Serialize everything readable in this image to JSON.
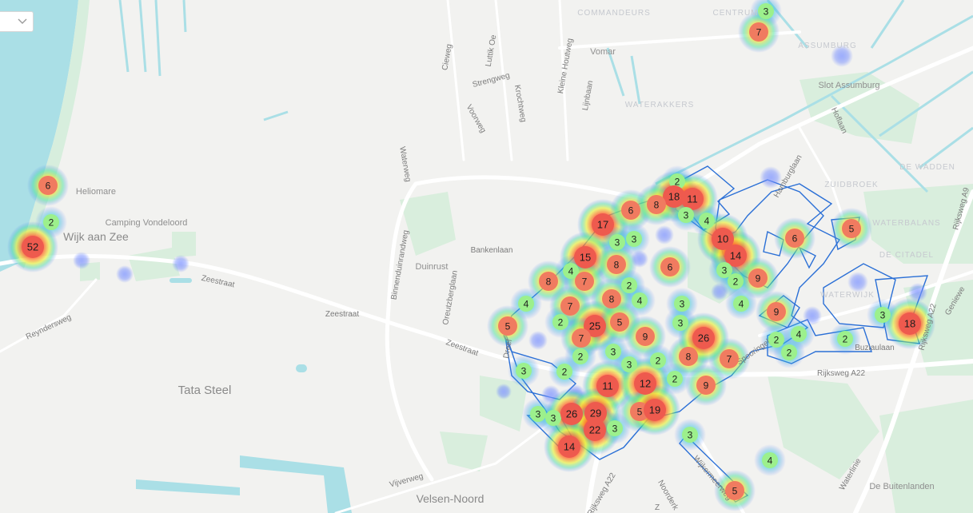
{
  "map": {
    "place_labels": [
      {
        "id": "commandeurs",
        "text": "COMMANDEURS",
        "variant": "district"
      },
      {
        "id": "centrum",
        "text": "CENTRUM",
        "variant": "district"
      },
      {
        "id": "assumburg",
        "text": "ASSUMBURG",
        "variant": "district"
      },
      {
        "id": "slot-assumburg",
        "text": "Slot Assumburg",
        "variant": "poi"
      },
      {
        "id": "waterakkers",
        "text": "WATERAKKERS",
        "variant": "district"
      },
      {
        "id": "zuidbroek",
        "text": "ZUIDBROEK",
        "variant": "district"
      },
      {
        "id": "de-wadden",
        "text": "DE WADDEN",
        "variant": "district"
      },
      {
        "id": "waterbalans",
        "text": "WATERBALANS",
        "variant": "district"
      },
      {
        "id": "de-citadel",
        "text": "DE CITADEL",
        "variant": "district"
      },
      {
        "id": "waterwijk",
        "text": "WATERWIJK",
        "variant": "district"
      },
      {
        "id": "heliomare",
        "text": "Heliomare",
        "variant": "poi"
      },
      {
        "id": "camping-vondeloord",
        "text": "Camping Vondeloord",
        "variant": "poi"
      },
      {
        "id": "wijk-aan-zee",
        "text": "Wijk aan Zee",
        "variant": "town"
      },
      {
        "id": "tata-steel",
        "text": "Tata Steel",
        "variant": "town"
      },
      {
        "id": "velsen-noord",
        "text": "Velsen-Noord",
        "variant": "town"
      },
      {
        "id": "duinrust",
        "text": "Duinrust",
        "variant": "poi"
      },
      {
        "id": "de-buitenlanden",
        "text": "De Buitenlanden",
        "variant": "poi"
      },
      {
        "id": "vomar",
        "text": "Vomar",
        "variant": "poi"
      }
    ],
    "street_labels": [
      {
        "id": "cieweg",
        "text": "Cieweg"
      },
      {
        "id": "luttik-oe",
        "text": "Luttik Oe"
      },
      {
        "id": "kleine-houtweg",
        "text": "Kleine Houtweg"
      },
      {
        "id": "lijnbaan",
        "text": "Lijnbaan"
      },
      {
        "id": "strengweg",
        "text": "Strengweg"
      },
      {
        "id": "voorweg",
        "text": "Voorweg"
      },
      {
        "id": "krocht",
        "text": "Krochtweg"
      },
      {
        "id": "waterweg",
        "text": "Waterweg"
      },
      {
        "id": "binnenduinrandweg",
        "text": "Binnenduinrandweg"
      },
      {
        "id": "bankenlaan",
        "text": "Bankenlaan"
      },
      {
        "id": "oreutzberglaan",
        "text": "Oreutzberglaan"
      },
      {
        "id": "zeestraat-1",
        "text": "Zeestraat"
      },
      {
        "id": "zeestraat-2",
        "text": "Zeestraat"
      },
      {
        "id": "zeestraat-3",
        "text": "Zeestraat"
      },
      {
        "id": "reyndersweg",
        "text": "Reyndersweg"
      },
      {
        "id": "dreef",
        "text": "Dreef"
      },
      {
        "id": "hoflaan",
        "text": "Hoflaan"
      },
      {
        "id": "hamburglaan",
        "text": "Hamburglaan"
      },
      {
        "id": "spooringel",
        "text": "Spooringel"
      },
      {
        "id": "rijksweg-a22-1",
        "text": "Rijksweg A22"
      },
      {
        "id": "rijksweg-a22-2",
        "text": "Rijksweg A22"
      },
      {
        "id": "rijksweg-a22-3",
        "text": "Rijksweg A22"
      },
      {
        "id": "rijksweg-a9",
        "text": "Rijksweg A9"
      },
      {
        "id": "buziaulaan",
        "text": "Buziaulaan"
      },
      {
        "id": "wijkermeerweg",
        "text": "Wijkermeerweg"
      },
      {
        "id": "noorderkade",
        "text": "Noorderk"
      },
      {
        "id": "vijverweg",
        "text": "Vijverweg"
      },
      {
        "id": "waterlinie",
        "text": "Waterlinie"
      },
      {
        "id": "geniewe",
        "text": "Geniewe"
      },
      {
        "id": "z",
        "text": "Z"
      }
    ],
    "cluster_markers": [
      {
        "count": "3",
        "level": "low"
      },
      {
        "count": "7",
        "level": "mid"
      },
      {
        "count": "6",
        "level": "mid"
      },
      {
        "count": "2",
        "level": "low"
      },
      {
        "count": "52",
        "level": "high"
      },
      {
        "count": "2",
        "level": "low"
      },
      {
        "count": "18",
        "level": "high"
      },
      {
        "count": "11",
        "level": "high"
      },
      {
        "count": "17",
        "level": "high"
      },
      {
        "count": "6",
        "level": "mid"
      },
      {
        "count": "8",
        "level": "mid"
      },
      {
        "count": "3",
        "level": "low"
      },
      {
        "count": "4",
        "level": "low"
      },
      {
        "count": "3",
        "level": "low"
      },
      {
        "count": "3",
        "level": "low"
      },
      {
        "count": "10",
        "level": "high"
      },
      {
        "count": "6",
        "level": "mid"
      },
      {
        "count": "5",
        "level": "mid"
      },
      {
        "count": "15",
        "level": "high"
      },
      {
        "count": "8",
        "level": "mid"
      },
      {
        "count": "14",
        "level": "high"
      },
      {
        "count": "8",
        "level": "mid"
      },
      {
        "count": "4",
        "level": "low"
      },
      {
        "count": "7",
        "level": "mid"
      },
      {
        "count": "6",
        "level": "mid"
      },
      {
        "count": "3",
        "level": "low"
      },
      {
        "count": "9",
        "level": "mid"
      },
      {
        "count": "2",
        "level": "low"
      },
      {
        "count": "2",
        "level": "low"
      },
      {
        "count": "4",
        "level": "low"
      },
      {
        "count": "8",
        "level": "mid"
      },
      {
        "count": "4",
        "level": "low"
      },
      {
        "count": "7",
        "level": "mid"
      },
      {
        "count": "3",
        "level": "low"
      },
      {
        "count": "9",
        "level": "mid"
      },
      {
        "count": "4",
        "level": "low"
      },
      {
        "count": "5",
        "level": "mid"
      },
      {
        "count": "2",
        "level": "low"
      },
      {
        "count": "25",
        "level": "high"
      },
      {
        "count": "5",
        "level": "mid"
      },
      {
        "count": "9",
        "level": "mid"
      },
      {
        "count": "3",
        "level": "low"
      },
      {
        "count": "7",
        "level": "mid"
      },
      {
        "count": "3",
        "level": "low"
      },
      {
        "count": "2",
        "level": "low"
      },
      {
        "count": "2",
        "level": "low"
      },
      {
        "count": "4",
        "level": "low"
      },
      {
        "count": "7",
        "level": "mid"
      },
      {
        "count": "2",
        "level": "low"
      },
      {
        "count": "2",
        "level": "low"
      },
      {
        "count": "3",
        "level": "low"
      },
      {
        "count": "18",
        "level": "high"
      },
      {
        "count": "8",
        "level": "mid"
      },
      {
        "count": "3",
        "level": "low"
      },
      {
        "count": "2",
        "level": "low"
      },
      {
        "count": "3",
        "level": "low"
      },
      {
        "count": "2",
        "level": "low"
      },
      {
        "count": "26",
        "level": "high"
      },
      {
        "count": "11",
        "level": "high"
      },
      {
        "count": "12",
        "level": "high"
      },
      {
        "count": "2",
        "level": "low"
      },
      {
        "count": "9",
        "level": "mid"
      },
      {
        "count": "3",
        "level": "low"
      },
      {
        "count": "3",
        "level": "low"
      },
      {
        "count": "26",
        "level": "high"
      },
      {
        "count": "29",
        "level": "high"
      },
      {
        "count": "5",
        "level": "mid"
      },
      {
        "count": "19",
        "level": "high"
      },
      {
        "count": "22",
        "level": "high"
      },
      {
        "count": "3",
        "level": "low"
      },
      {
        "count": "14",
        "level": "high"
      },
      {
        "count": "3",
        "level": "low"
      },
      {
        "count": "4",
        "level": "low"
      },
      {
        "count": "5",
        "level": "mid"
      }
    ],
    "colors": {
      "land": "#f2f2f0",
      "water": "#aadfe6",
      "park": "#d9eedd",
      "road": "#ffffff",
      "region_outline": "#2a6fd6",
      "marker_low": "#9cf08c",
      "marker_mid": "#f07b60",
      "marker_high": "#ee5a4e"
    }
  },
  "controls": {
    "dropdown_icon": "chevron-down-icon"
  }
}
